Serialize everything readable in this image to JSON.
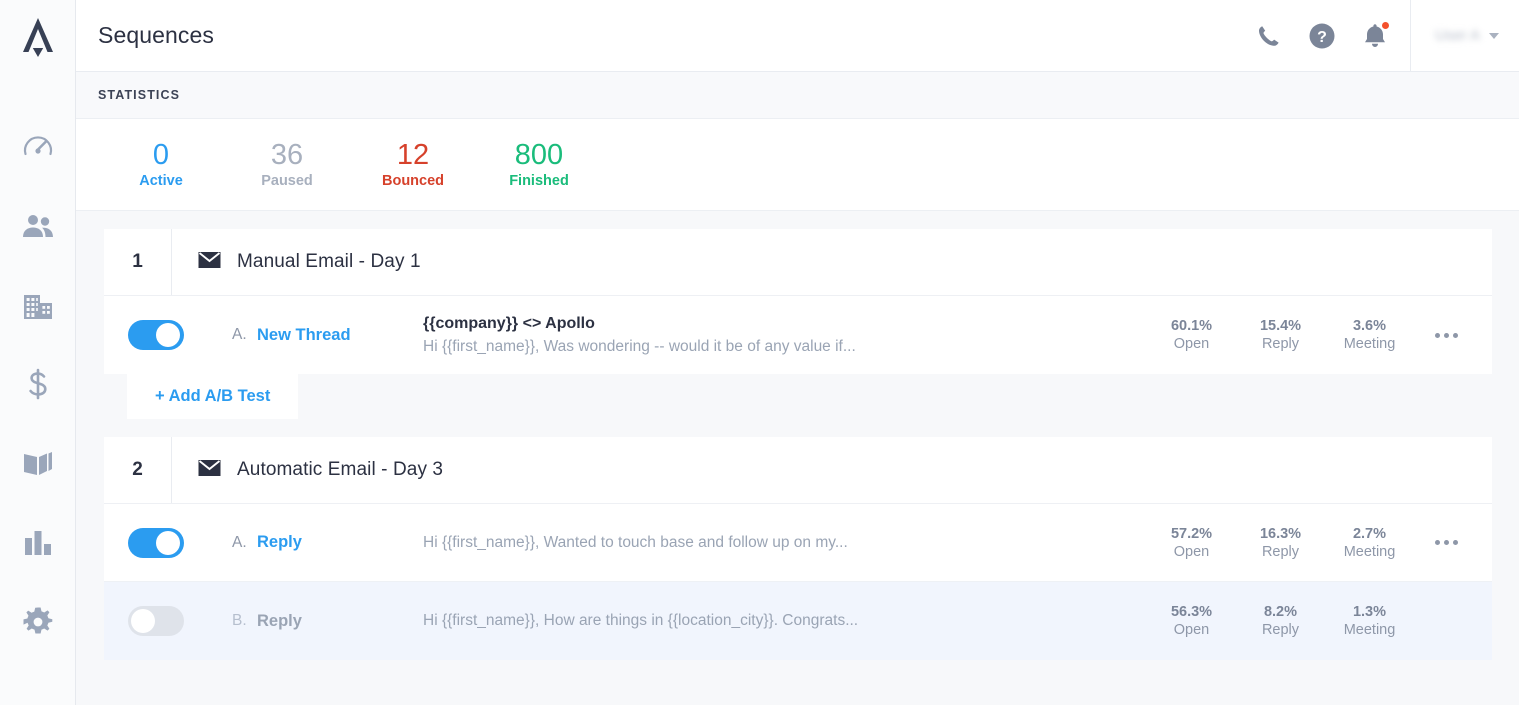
{
  "app": {
    "logo_icon": "apollo-logo-icon",
    "sidebar": {
      "items": [
        {
          "icon": "speedometer-icon",
          "name": "dashboard"
        },
        {
          "icon": "people-icon",
          "name": "contacts"
        },
        {
          "icon": "building-icon",
          "name": "accounts"
        },
        {
          "icon": "dollar-icon",
          "name": "opportunities"
        },
        {
          "icon": "book-icon",
          "name": "sequences"
        },
        {
          "icon": "bar-chart-icon",
          "name": "analytics"
        },
        {
          "icon": "gear-icon",
          "name": "settings"
        }
      ]
    }
  },
  "header": {
    "title": "Sequences",
    "icons": [
      {
        "icon": "phone-icon",
        "name": "phone"
      },
      {
        "icon": "help-circle-icon",
        "name": "help"
      },
      {
        "icon": "bell-icon",
        "name": "notifications",
        "has_badge": true
      }
    ],
    "user_name": "User A",
    "caret_icon": "chevron-down-icon"
  },
  "statistics": {
    "section_label": "STATISTICS",
    "items": [
      {
        "value": "0",
        "label": "Active",
        "color": "#2b9cf0"
      },
      {
        "value": "36",
        "label": "Paused",
        "color": "#a8b0be"
      },
      {
        "value": "12",
        "label": "Bounced",
        "color": "#d6412b"
      },
      {
        "value": "800",
        "label": "Finished",
        "color": "#1abc7b"
      }
    ]
  },
  "steps": [
    {
      "number": "1",
      "icon": "envelope-icon",
      "title": "Manual Email - Day 1",
      "variants": [
        {
          "enabled": true,
          "letter": "A.",
          "name": "New Thread",
          "subject": "{{company}} <> Apollo",
          "preview": "Hi {{first_name}}, Was wondering -- would it be of any value if...",
          "metrics": [
            {
              "value": "60.1%",
              "label": "Open"
            },
            {
              "value": "15.4%",
              "label": "Reply"
            },
            {
              "value": "3.6%",
              "label": "Meeting"
            }
          ],
          "has_menu": true
        }
      ],
      "add_ab_test_label": "+ Add A/B Test"
    },
    {
      "number": "2",
      "icon": "envelope-icon",
      "title": "Automatic Email - Day 3",
      "variants": [
        {
          "enabled": true,
          "letter": "A.",
          "name": "Reply",
          "subject": "",
          "preview": "Hi {{first_name}}, Wanted to touch base and follow up on my...",
          "metrics": [
            {
              "value": "57.2%",
              "label": "Open"
            },
            {
              "value": "16.3%",
              "label": "Reply"
            },
            {
              "value": "2.7%",
              "label": "Meeting"
            }
          ],
          "has_menu": true
        },
        {
          "enabled": false,
          "letter": "B.",
          "name": "Reply",
          "subject": "",
          "preview": "Hi {{first_name}}, How are things in {{location_city}}. Congrats...",
          "metrics": [
            {
              "value": "56.3%",
              "label": "Open"
            },
            {
              "value": "8.2%",
              "label": "Reply"
            },
            {
              "value": "1.3%",
              "label": "Meeting"
            }
          ],
          "has_menu": false
        }
      ],
      "add_ab_test_label": ""
    }
  ]
}
